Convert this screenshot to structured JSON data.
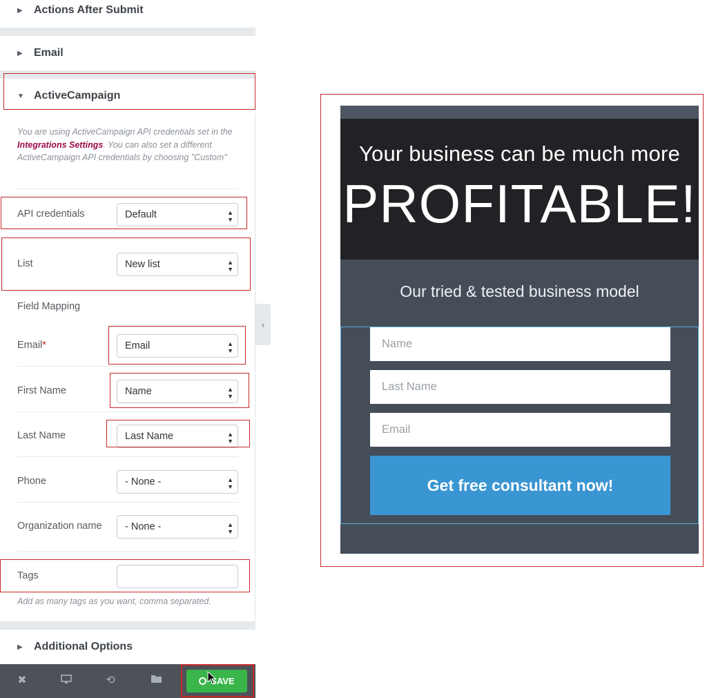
{
  "sidebar": {
    "sections": {
      "actions_after_submit": "Actions After Submit",
      "email": "Email",
      "active_campaign": "ActiveCampaign",
      "additional_options": "Additional Options"
    },
    "description": {
      "part1": "You are using ActiveCampaign API credentials set in the ",
      "link": "Integrations Settings",
      "part2": ". You can also set a different ActiveCampaign API credentials by choosing \"Custom\""
    },
    "fields": {
      "api_credentials": {
        "label": "API credentials",
        "value": "Default"
      },
      "list": {
        "label": "List",
        "value": "New list"
      },
      "field_mapping": "Field Mapping",
      "email": {
        "label": "Email",
        "required_mark": "*",
        "value": "Email"
      },
      "first_name": {
        "label": "First Name",
        "value": "Name"
      },
      "last_name": {
        "label": "Last Name",
        "value": "Last Name"
      },
      "phone": {
        "label": "Phone",
        "value": "- None -"
      },
      "organization": {
        "label": "Organization name",
        "value": "- None -"
      },
      "tags": {
        "label": "Tags",
        "value": ""
      }
    },
    "tags_note": "Add as many tags as you want, comma separated."
  },
  "bottombar": {
    "save_label": "SAVE",
    "icons": [
      "close-icon",
      "desktop-icon",
      "history-icon",
      "folder-icon"
    ]
  },
  "preview": {
    "headline1": "Your business can be much more",
    "headline2": "PROFITABLE!",
    "subheadline": "Our tried & tested business model",
    "inputs": {
      "name": "Name",
      "last_name": "Last Name",
      "email": "Email"
    },
    "cta": "Get free consultant now!"
  },
  "colors": {
    "accent_red": "#c62828",
    "save_green": "#39b54a",
    "cta_blue": "#3a95d3",
    "card_dark": "#222226",
    "card_slate": "#454d59"
  }
}
